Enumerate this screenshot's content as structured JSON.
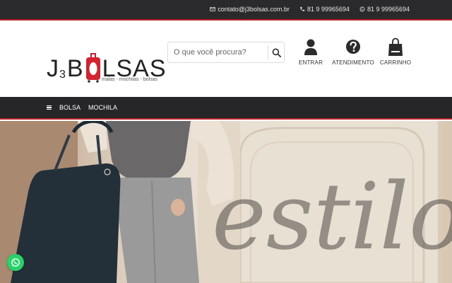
{
  "topbar": {
    "email": "contato@j3bolsas.com.br",
    "phone": "81 9 99965694",
    "whatsapp": "81 9 99965694"
  },
  "logo": {
    "prefix": "J",
    "number": "3",
    "brand_b": "B",
    "brand_rest": "LSAS",
    "tagline": "malas - mochilas - bolsas"
  },
  "search": {
    "placeholder": "O que você procura?"
  },
  "header_actions": {
    "login": "ENTRAR",
    "support": "ATENDIMENTO",
    "cart": "CARRINHO"
  },
  "nav": {
    "items": [
      "BOLSA",
      "MOCHILA"
    ]
  },
  "banner": {
    "script_text": "estilo"
  },
  "colors": {
    "topbar": "#2a2a2c",
    "accent_red": "#b8222a",
    "whatsapp": "#25d366"
  }
}
